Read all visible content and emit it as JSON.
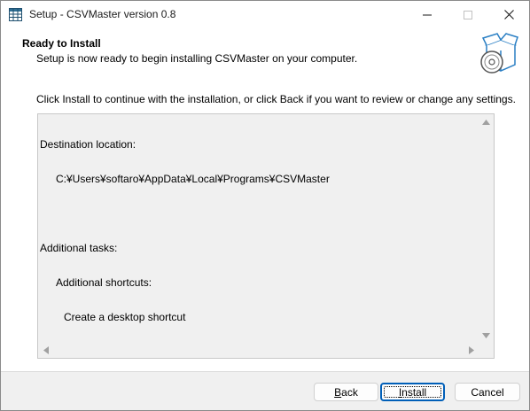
{
  "window": {
    "title": "Setup - CSVMaster version 0.8"
  },
  "header": {
    "title": "Ready to Install",
    "subtitle": "Setup is now ready to begin installing CSVMaster on your computer."
  },
  "body": {
    "instruction": "Click Install to continue with the installation, or click Back if you want to review or change any settings.",
    "memo": {
      "destination_label": "Destination location:",
      "destination_path": "C:¥Users¥softaro¥AppData¥Local¥Programs¥CSVMaster",
      "tasks_label": "Additional tasks:",
      "shortcuts_label": "Additional shortcuts:",
      "shortcut_item": "Create a desktop shortcut"
    }
  },
  "footer": {
    "back_prefix": "",
    "back_accel": "B",
    "back_rest": "ack",
    "install_prefix": "",
    "install_accel": "I",
    "install_rest": "nstall",
    "cancel_label": "Cancel"
  },
  "icons": {
    "app": "spreadsheet-grid-icon",
    "wizard": "box-with-disc-icon"
  },
  "colors": {
    "accent": "#005fb8",
    "icon_blue": "#2a7fc4"
  }
}
